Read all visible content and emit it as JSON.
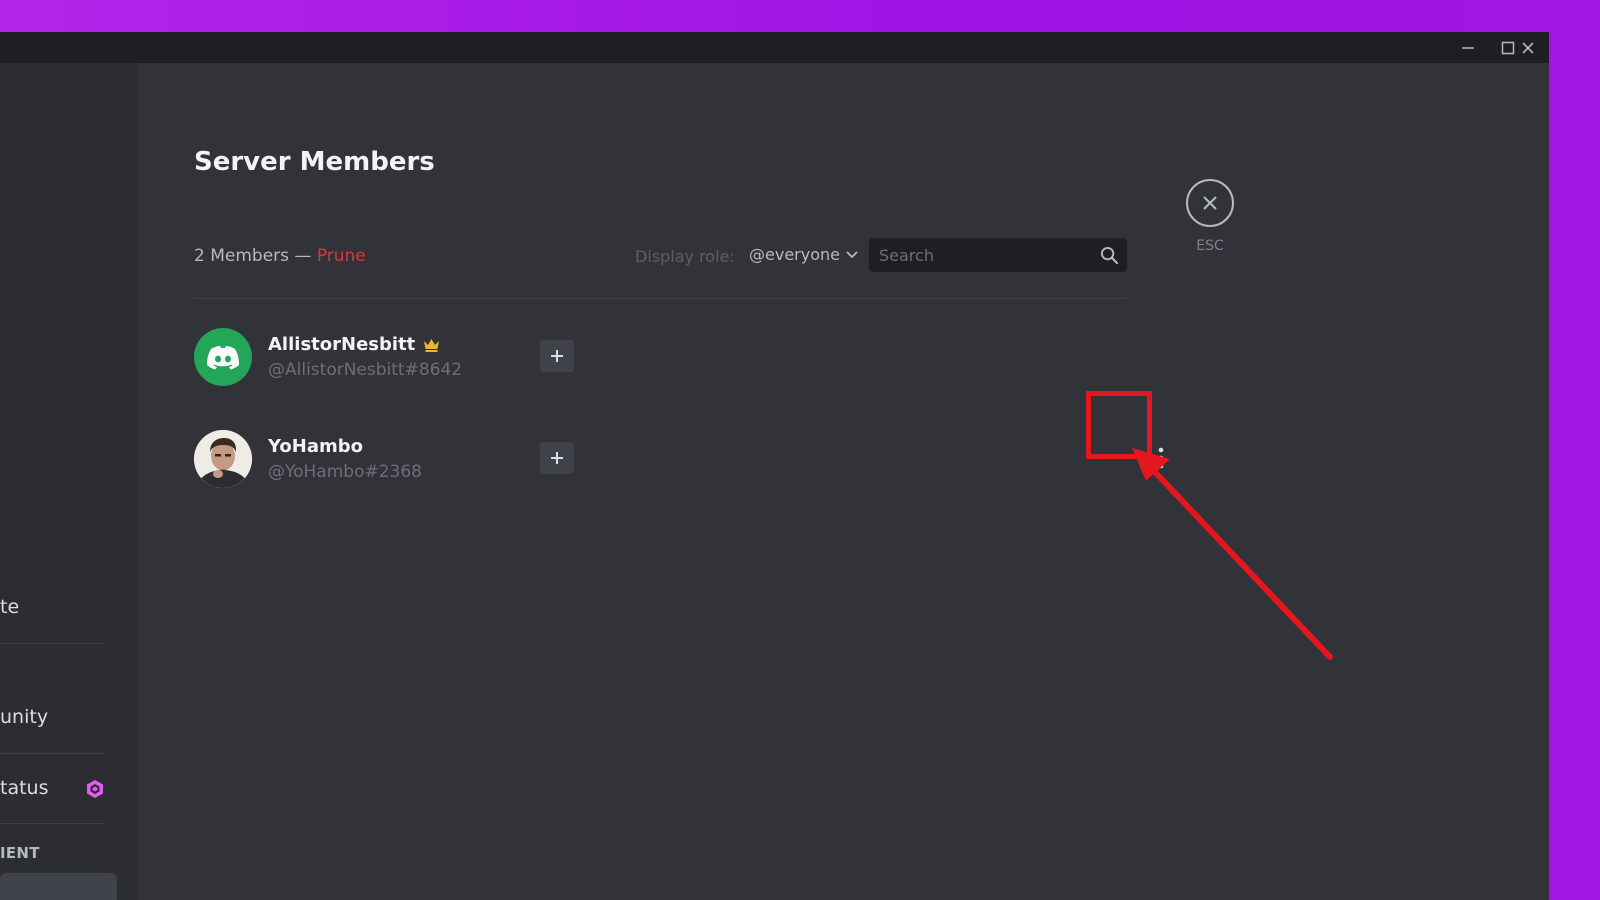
{
  "window": {
    "controls": [
      "minimize",
      "maximize",
      "close"
    ]
  },
  "sidebar": {
    "items": [
      {
        "label": "te"
      },
      {
        "label": "unity"
      },
      {
        "label": "tatus"
      }
    ],
    "section_label": "IENT"
  },
  "header": {
    "title": "Server Members",
    "members_count": "2 Members —",
    "prune_label": "Prune",
    "display_role_label": "Display role:",
    "role_value": "@everyone",
    "search_placeholder": "Search",
    "esc_label": "ESC"
  },
  "members": [
    {
      "name": "AllistorNesbitt",
      "tag": "@AllistorNesbitt#8642",
      "owner": true
    },
    {
      "name": "YoHambo",
      "tag": "@YoHambo#2368",
      "owner": false
    }
  ],
  "colors": {
    "accent_red": "#da373c",
    "annotation_red": "#e4161e",
    "avatar_green": "#23a55a",
    "boost_pink": "#eb59f4"
  },
  "icons": [
    "discord-logo-icon",
    "crown-icon",
    "plus-icon",
    "more-vertical-icon",
    "search-icon",
    "close-icon",
    "chevron-down-icon",
    "nitro-boost-icon"
  ]
}
